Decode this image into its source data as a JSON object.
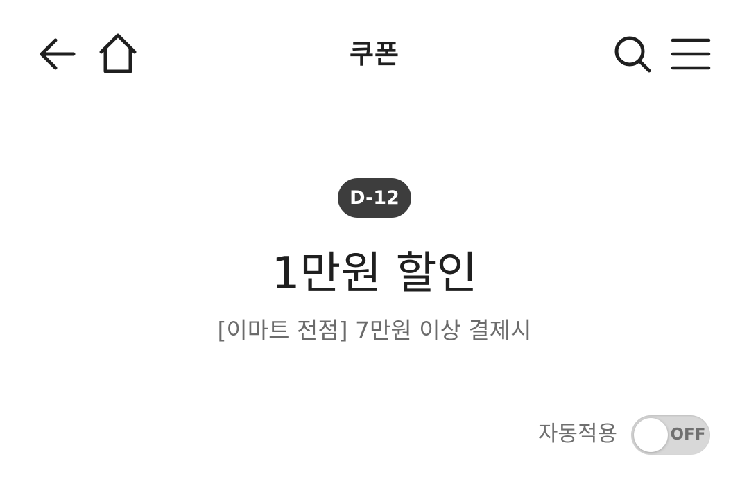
{
  "header": {
    "title": "쿠폰",
    "icons": {
      "back": "arrow-left-icon",
      "home": "home-icon",
      "search": "search-icon",
      "menu": "hamburger-menu-icon"
    }
  },
  "coupon": {
    "dday": "D-12",
    "title": "1만원 할인",
    "description": "[이마트 전점] 7만원 이상 결제시"
  },
  "auto_apply": {
    "label": "자동적용",
    "toggle_state": "OFF"
  },
  "colors": {
    "text_primary": "#1f1f1f",
    "text_secondary": "#6b6b6b",
    "badge_bg": "#3d3d3d",
    "toggle_track": "#d8d8d8"
  }
}
